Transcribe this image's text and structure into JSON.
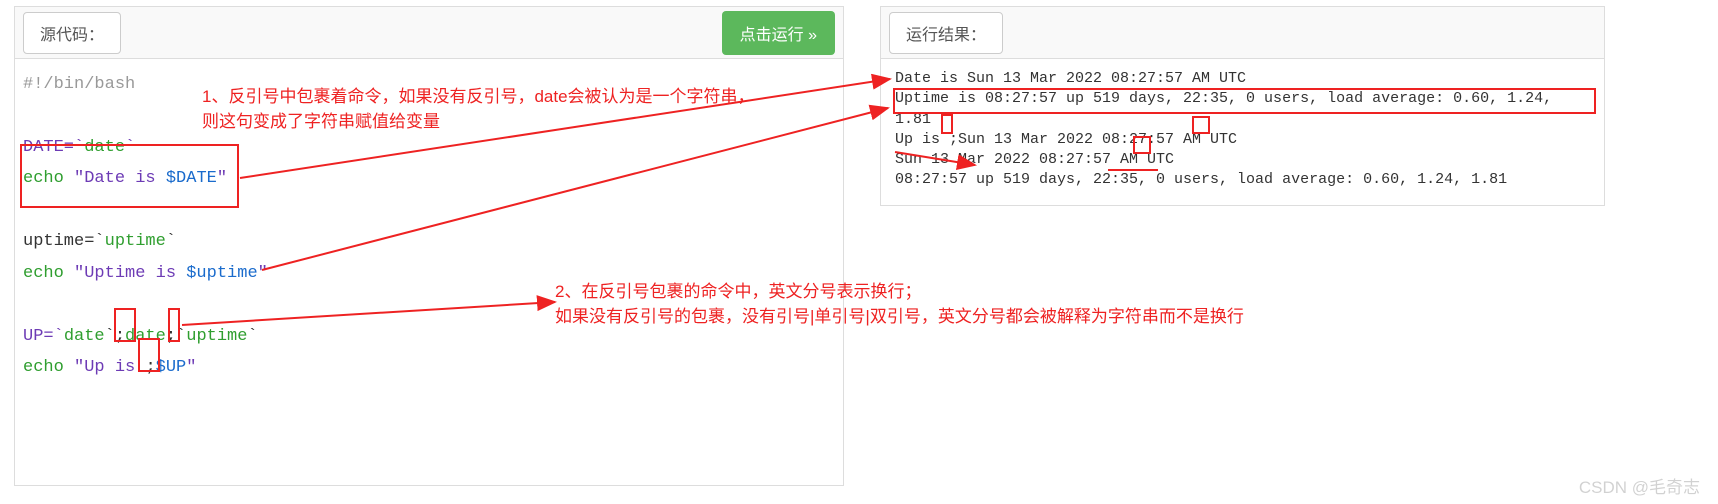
{
  "left": {
    "title": "源代码：",
    "run": "点击运行 »",
    "shebang": "#!/bin/bash",
    "l1_a": "DATE=`",
    "l1_b": "date",
    "l1_c": "`",
    "l2_a": "echo ",
    "l2_b": "\"Date is ",
    "l2_c": "$DATE",
    "l2_d": "\"",
    "l3_a": "uptime=`",
    "l3_b": "uptime",
    "l3_c": "`",
    "l4_a": "echo ",
    "l4_b": "\"Uptime is ",
    "l4_c": "$uptime",
    "l4_d": "\"",
    "l5_a": "UP=`",
    "l5_b": "date",
    "l5_c": "`;",
    "l5_d": "date",
    "l5_e": ";`",
    "l5_f": "uptime",
    "l5_g": "`",
    "l6_a": "echo ",
    "l6_b": "\"Up is ",
    "l6_c": ";",
    "l6_d": "$UP",
    "l6_e": "\""
  },
  "right": {
    "title": "运行结果：",
    "o1": "Date is Sun 13 Mar 2022 08:27:57 AM UTC",
    "o2": "Uptime is  08:27:57 up 519 days, 22:35,  0 users,  load average: 0.60, 1.24, 1.81",
    "o3": "Up is ;Sun 13 Mar 2022 08:27:57 AM UTC",
    "o4": "Sun 13 Mar 2022 08:27:57 AM UTC",
    "o5": " 08:27:57 up 519 days, 22:35,  0 users,  load average: 0.60, 1.24, 1.81"
  },
  "anno": {
    "a1": "1、反引号中包裹着命令，如果没有反引号，date会被认为是一个字符串，\n则这句变成了字符串赋值给变量",
    "a2": "2、在反引号包裹的命令中，英文分号表示换行；\n如果没有反引号的包裹，没有引号|单引号|双引号，英文分号都会被解释为字符串而不是换行"
  },
  "watermark": "CSDN @毛奇志"
}
